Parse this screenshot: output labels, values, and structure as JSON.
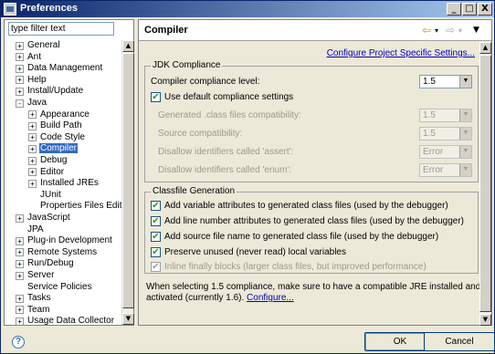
{
  "window": {
    "title": "Preferences",
    "controls": [
      "_",
      "□",
      "X"
    ]
  },
  "filter": {
    "value": "type filter text"
  },
  "tree": [
    {
      "label": "General",
      "exp": "+",
      "indent": 0
    },
    {
      "label": "Ant",
      "exp": "+",
      "indent": 0
    },
    {
      "label": "Data Management",
      "exp": "+",
      "indent": 0
    },
    {
      "label": "Help",
      "exp": "+",
      "indent": 0
    },
    {
      "label": "Install/Update",
      "exp": "+",
      "indent": 0
    },
    {
      "label": "Java",
      "exp": "-",
      "indent": 0
    },
    {
      "label": "Appearance",
      "exp": "+",
      "indent": 1
    },
    {
      "label": "Build Path",
      "exp": "+",
      "indent": 1
    },
    {
      "label": "Code Style",
      "exp": "+",
      "indent": 1
    },
    {
      "label": "Compiler",
      "exp": "+",
      "indent": 1,
      "selected": true
    },
    {
      "label": "Debug",
      "exp": "+",
      "indent": 1
    },
    {
      "label": "Editor",
      "exp": "+",
      "indent": 1
    },
    {
      "label": "Installed JREs",
      "exp": "+",
      "indent": 1
    },
    {
      "label": "JUnit",
      "exp": "",
      "indent": 1
    },
    {
      "label": "Properties Files Editor",
      "exp": "",
      "indent": 1
    },
    {
      "label": "JavaScript",
      "exp": "+",
      "indent": 0
    },
    {
      "label": "JPA",
      "exp": "",
      "indent": 0
    },
    {
      "label": "Plug-in Development",
      "exp": "+",
      "indent": 0
    },
    {
      "label": "Remote Systems",
      "exp": "+",
      "indent": 0
    },
    {
      "label": "Run/Debug",
      "exp": "+",
      "indent": 0
    },
    {
      "label": "Server",
      "exp": "+",
      "indent": 0
    },
    {
      "label": "Service Policies",
      "exp": "",
      "indent": 0
    },
    {
      "label": "Tasks",
      "exp": "+",
      "indent": 0
    },
    {
      "label": "Team",
      "exp": "+",
      "indent": 0
    },
    {
      "label": "Usage Data Collector",
      "exp": "+",
      "indent": 0
    }
  ],
  "page": {
    "title": "Compiler",
    "config_link": "Configure Project Specific Settings...",
    "jdk": {
      "title": "JDK Compliance",
      "level_label": "Compiler compliance level:",
      "level_value": "1.5",
      "use_default": "Use default compliance settings",
      "generated_label": "Generated .class files compatibility:",
      "generated_value": "1.5",
      "source_label": "Source compatibility:",
      "source_value": "1.5",
      "assert_label": "Disallow identifiers called 'assert':",
      "assert_value": "Error",
      "enum_label": "Disallow identifiers called 'enum':",
      "enum_value": "Error"
    },
    "classfile": {
      "title": "Classfile Generation",
      "opt1": "Add variable attributes to generated class files (used by the debugger)",
      "opt2": "Add line number attributes to generated class files (used by the debugger)",
      "opt3": "Add source file name to generated class file (used by the debugger)",
      "opt4": "Preserve unused (never read) local variables",
      "opt5": "Inline finally blocks (larger class files, but improved performance)"
    },
    "note": "When selecting 1.5 compliance, make sure to have a compatible JRE installed and activated (currently 1.6).",
    "note_link": "Configure..."
  },
  "buttons": {
    "help": "?",
    "ok": "OK",
    "cancel": "Cancel"
  },
  "icons": {
    "back": "back-arrow-icon",
    "forward": "forward-arrow-icon",
    "menu": "view-menu-icon"
  }
}
